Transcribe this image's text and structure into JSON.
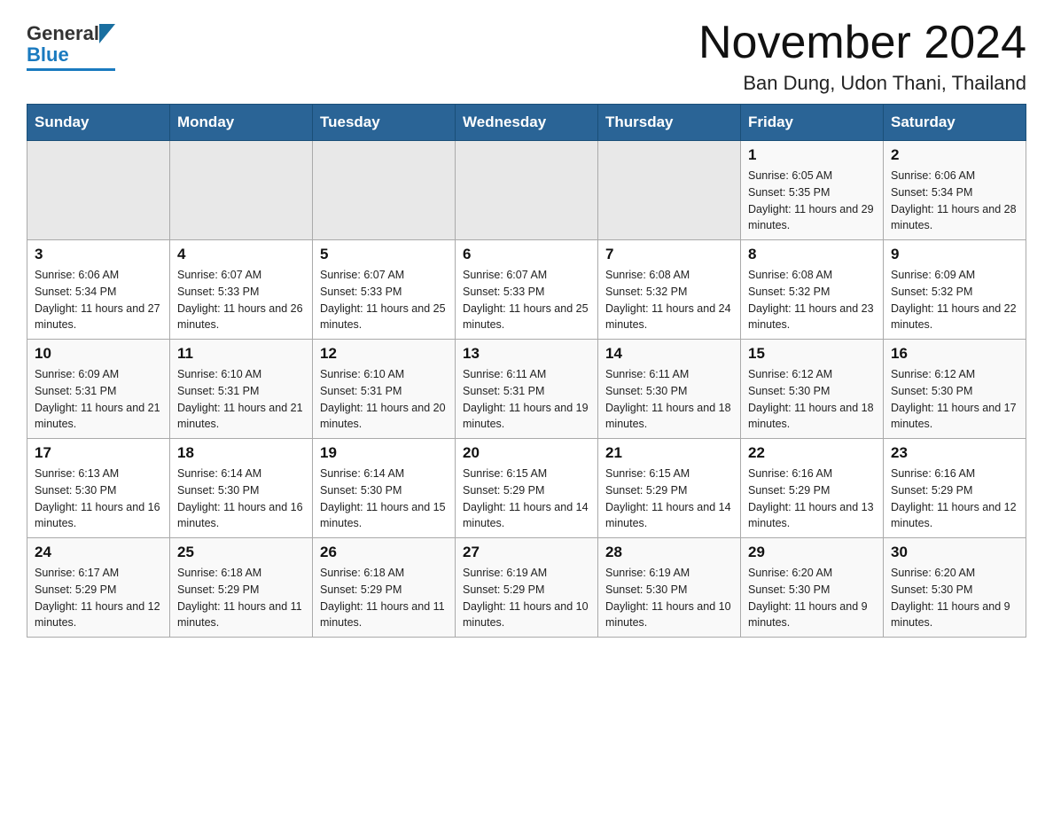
{
  "header": {
    "logo_general": "General",
    "logo_blue": "Blue",
    "title": "November 2024",
    "subtitle": "Ban Dung, Udon Thani, Thailand"
  },
  "days_of_week": [
    "Sunday",
    "Monday",
    "Tuesday",
    "Wednesday",
    "Thursday",
    "Friday",
    "Saturday"
  ],
  "weeks": [
    [
      {
        "day": "",
        "info": ""
      },
      {
        "day": "",
        "info": ""
      },
      {
        "day": "",
        "info": ""
      },
      {
        "day": "",
        "info": ""
      },
      {
        "day": "",
        "info": ""
      },
      {
        "day": "1",
        "info": "Sunrise: 6:05 AM\nSunset: 5:35 PM\nDaylight: 11 hours and 29 minutes."
      },
      {
        "day": "2",
        "info": "Sunrise: 6:06 AM\nSunset: 5:34 PM\nDaylight: 11 hours and 28 minutes."
      }
    ],
    [
      {
        "day": "3",
        "info": "Sunrise: 6:06 AM\nSunset: 5:34 PM\nDaylight: 11 hours and 27 minutes."
      },
      {
        "day": "4",
        "info": "Sunrise: 6:07 AM\nSunset: 5:33 PM\nDaylight: 11 hours and 26 minutes."
      },
      {
        "day": "5",
        "info": "Sunrise: 6:07 AM\nSunset: 5:33 PM\nDaylight: 11 hours and 25 minutes."
      },
      {
        "day": "6",
        "info": "Sunrise: 6:07 AM\nSunset: 5:33 PM\nDaylight: 11 hours and 25 minutes."
      },
      {
        "day": "7",
        "info": "Sunrise: 6:08 AM\nSunset: 5:32 PM\nDaylight: 11 hours and 24 minutes."
      },
      {
        "day": "8",
        "info": "Sunrise: 6:08 AM\nSunset: 5:32 PM\nDaylight: 11 hours and 23 minutes."
      },
      {
        "day": "9",
        "info": "Sunrise: 6:09 AM\nSunset: 5:32 PM\nDaylight: 11 hours and 22 minutes."
      }
    ],
    [
      {
        "day": "10",
        "info": "Sunrise: 6:09 AM\nSunset: 5:31 PM\nDaylight: 11 hours and 21 minutes."
      },
      {
        "day": "11",
        "info": "Sunrise: 6:10 AM\nSunset: 5:31 PM\nDaylight: 11 hours and 21 minutes."
      },
      {
        "day": "12",
        "info": "Sunrise: 6:10 AM\nSunset: 5:31 PM\nDaylight: 11 hours and 20 minutes."
      },
      {
        "day": "13",
        "info": "Sunrise: 6:11 AM\nSunset: 5:31 PM\nDaylight: 11 hours and 19 minutes."
      },
      {
        "day": "14",
        "info": "Sunrise: 6:11 AM\nSunset: 5:30 PM\nDaylight: 11 hours and 18 minutes."
      },
      {
        "day": "15",
        "info": "Sunrise: 6:12 AM\nSunset: 5:30 PM\nDaylight: 11 hours and 18 minutes."
      },
      {
        "day": "16",
        "info": "Sunrise: 6:12 AM\nSunset: 5:30 PM\nDaylight: 11 hours and 17 minutes."
      }
    ],
    [
      {
        "day": "17",
        "info": "Sunrise: 6:13 AM\nSunset: 5:30 PM\nDaylight: 11 hours and 16 minutes."
      },
      {
        "day": "18",
        "info": "Sunrise: 6:14 AM\nSunset: 5:30 PM\nDaylight: 11 hours and 16 minutes."
      },
      {
        "day": "19",
        "info": "Sunrise: 6:14 AM\nSunset: 5:30 PM\nDaylight: 11 hours and 15 minutes."
      },
      {
        "day": "20",
        "info": "Sunrise: 6:15 AM\nSunset: 5:29 PM\nDaylight: 11 hours and 14 minutes."
      },
      {
        "day": "21",
        "info": "Sunrise: 6:15 AM\nSunset: 5:29 PM\nDaylight: 11 hours and 14 minutes."
      },
      {
        "day": "22",
        "info": "Sunrise: 6:16 AM\nSunset: 5:29 PM\nDaylight: 11 hours and 13 minutes."
      },
      {
        "day": "23",
        "info": "Sunrise: 6:16 AM\nSunset: 5:29 PM\nDaylight: 11 hours and 12 minutes."
      }
    ],
    [
      {
        "day": "24",
        "info": "Sunrise: 6:17 AM\nSunset: 5:29 PM\nDaylight: 11 hours and 12 minutes."
      },
      {
        "day": "25",
        "info": "Sunrise: 6:18 AM\nSunset: 5:29 PM\nDaylight: 11 hours and 11 minutes."
      },
      {
        "day": "26",
        "info": "Sunrise: 6:18 AM\nSunset: 5:29 PM\nDaylight: 11 hours and 11 minutes."
      },
      {
        "day": "27",
        "info": "Sunrise: 6:19 AM\nSunset: 5:29 PM\nDaylight: 11 hours and 10 minutes."
      },
      {
        "day": "28",
        "info": "Sunrise: 6:19 AM\nSunset: 5:30 PM\nDaylight: 11 hours and 10 minutes."
      },
      {
        "day": "29",
        "info": "Sunrise: 6:20 AM\nSunset: 5:30 PM\nDaylight: 11 hours and 9 minutes."
      },
      {
        "day": "30",
        "info": "Sunrise: 6:20 AM\nSunset: 5:30 PM\nDaylight: 11 hours and 9 minutes."
      }
    ]
  ]
}
